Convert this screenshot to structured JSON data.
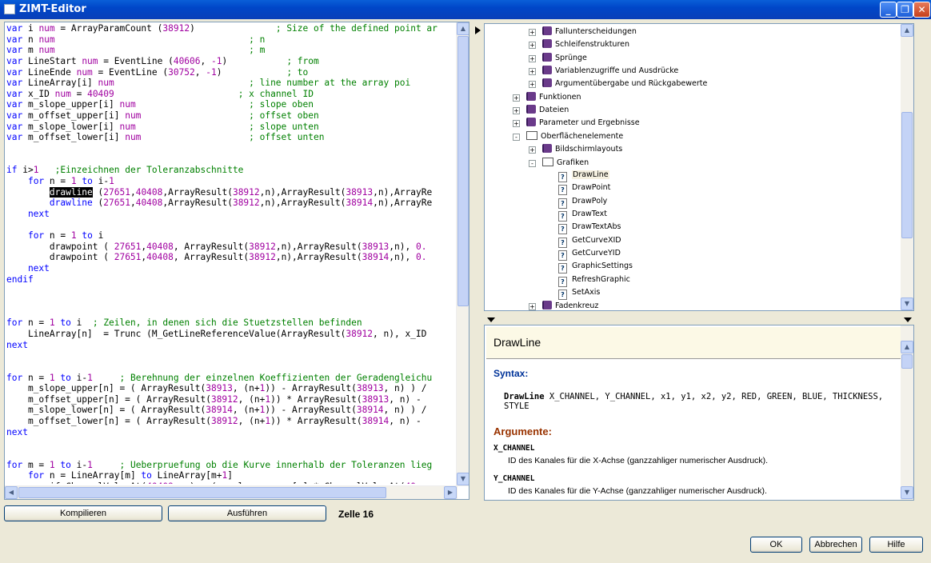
{
  "window": {
    "title": "ZIMT-Editor",
    "min_icon": "minimize-icon",
    "max_icon": "maximize-icon",
    "close_icon": "close-icon",
    "min_glyph": "_",
    "max_glyph": "❐",
    "close_glyph": "✕"
  },
  "code_lines": [
    [
      {
        "t": "var",
        "c": "kw"
      },
      {
        "t": " i "
      },
      {
        "t": "num",
        "c": "nm"
      },
      {
        "t": " = ArrayParamCount ("
      },
      {
        "t": "38912",
        "c": "nm"
      },
      {
        "t": ")               "
      },
      {
        "t": "; Size of the defined point ar",
        "c": "cm"
      }
    ],
    [
      {
        "t": "var",
        "c": "kw"
      },
      {
        "t": " n "
      },
      {
        "t": "num",
        "c": "nm"
      },
      {
        "t": "                                    "
      },
      {
        "t": "; n",
        "c": "cm"
      }
    ],
    [
      {
        "t": "var",
        "c": "kw"
      },
      {
        "t": " m "
      },
      {
        "t": "num",
        "c": "nm"
      },
      {
        "t": "                                    "
      },
      {
        "t": "; m",
        "c": "cm"
      }
    ],
    [
      {
        "t": "var",
        "c": "kw"
      },
      {
        "t": " LineStart "
      },
      {
        "t": "num",
        "c": "nm"
      },
      {
        "t": " = EventLine ("
      },
      {
        "t": "40606",
        "c": "nm"
      },
      {
        "t": ", "
      },
      {
        "t": "-1",
        "c": "nm"
      },
      {
        "t": ")           "
      },
      {
        "t": "; from",
        "c": "cm"
      }
    ],
    [
      {
        "t": "var",
        "c": "kw"
      },
      {
        "t": " LineEnde "
      },
      {
        "t": "num",
        "c": "nm"
      },
      {
        "t": " = EventLine ("
      },
      {
        "t": "30752",
        "c": "nm"
      },
      {
        "t": ", "
      },
      {
        "t": "-1",
        "c": "nm"
      },
      {
        "t": ")            "
      },
      {
        "t": "; to",
        "c": "cm"
      }
    ],
    [
      {
        "t": "var",
        "c": "kw"
      },
      {
        "t": " LineArray[i] "
      },
      {
        "t": "num",
        "c": "nm"
      },
      {
        "t": "                         "
      },
      {
        "t": "; line number at the array poi",
        "c": "cm"
      }
    ],
    [
      {
        "t": "var",
        "c": "kw"
      },
      {
        "t": " x_ID "
      },
      {
        "t": "num",
        "c": "nm"
      },
      {
        "t": " = "
      },
      {
        "t": "40409",
        "c": "nm"
      },
      {
        "t": "                       "
      },
      {
        "t": "; x channel ID",
        "c": "cm"
      }
    ],
    [
      {
        "t": "var",
        "c": "kw"
      },
      {
        "t": " m_slope_upper[i] "
      },
      {
        "t": "num",
        "c": "nm"
      },
      {
        "t": "                     "
      },
      {
        "t": "; slope oben",
        "c": "cm"
      }
    ],
    [
      {
        "t": "var",
        "c": "kw"
      },
      {
        "t": " m_offset_upper[i] "
      },
      {
        "t": "num",
        "c": "nm"
      },
      {
        "t": "                    "
      },
      {
        "t": "; offset oben",
        "c": "cm"
      }
    ],
    [
      {
        "t": "var",
        "c": "kw"
      },
      {
        "t": " m_slope_lower[i] "
      },
      {
        "t": "num",
        "c": "nm"
      },
      {
        "t": "                     "
      },
      {
        "t": "; slope unten",
        "c": "cm"
      }
    ],
    [
      {
        "t": "var",
        "c": "kw"
      },
      {
        "t": " m_offset_lower[i] "
      },
      {
        "t": "num",
        "c": "nm"
      },
      {
        "t": "                    "
      },
      {
        "t": "; offset unten",
        "c": "cm"
      }
    ],
    [],
    [],
    [
      {
        "t": "if",
        "c": "kw"
      },
      {
        "t": " i>"
      },
      {
        "t": "1",
        "c": "nm"
      },
      {
        "t": "   "
      },
      {
        "t": ";Einzeichnen der Toleranzabschnitte",
        "c": "cm"
      }
    ],
    [
      {
        "t": "    "
      },
      {
        "t": "for",
        "c": "kw"
      },
      {
        "t": " n = "
      },
      {
        "t": "1",
        "c": "nm"
      },
      {
        "t": " "
      },
      {
        "t": "to",
        "c": "kw"
      },
      {
        "t": " i-"
      },
      {
        "t": "1",
        "c": "nm"
      }
    ],
    [
      {
        "t": "        "
      },
      {
        "t": "drawline",
        "c": "sel"
      },
      {
        "t": " ("
      },
      {
        "t": "27651",
        "c": "nm"
      },
      {
        "t": ","
      },
      {
        "t": "40408",
        "c": "nm"
      },
      {
        "t": ",ArrayResult("
      },
      {
        "t": "38912",
        "c": "nm"
      },
      {
        "t": ",n),ArrayResult("
      },
      {
        "t": "38913",
        "c": "nm"
      },
      {
        "t": ",n),ArrayRe"
      }
    ],
    [
      {
        "t": "        drawline",
        "c": "kw"
      },
      {
        "t": " ("
      },
      {
        "t": "27651",
        "c": "nm"
      },
      {
        "t": ","
      },
      {
        "t": "40408",
        "c": "nm"
      },
      {
        "t": ",ArrayResult("
      },
      {
        "t": "38912",
        "c": "nm"
      },
      {
        "t": ",n),ArrayResult("
      },
      {
        "t": "38914",
        "c": "nm"
      },
      {
        "t": ",n),ArrayRe"
      }
    ],
    [
      {
        "t": "    next",
        "c": "kw"
      }
    ],
    [],
    [
      {
        "t": "    "
      },
      {
        "t": "for",
        "c": "kw"
      },
      {
        "t": " n = "
      },
      {
        "t": "1",
        "c": "nm"
      },
      {
        "t": " "
      },
      {
        "t": "to",
        "c": "kw"
      },
      {
        "t": " i"
      }
    ],
    [
      {
        "t": "        drawpoint ( "
      },
      {
        "t": "27651",
        "c": "nm"
      },
      {
        "t": ","
      },
      {
        "t": "40408",
        "c": "nm"
      },
      {
        "t": ", ArrayResult("
      },
      {
        "t": "38912",
        "c": "nm"
      },
      {
        "t": ",n),ArrayResult("
      },
      {
        "t": "38913",
        "c": "nm"
      },
      {
        "t": ",n), "
      },
      {
        "t": "0.",
        "c": "nm"
      }
    ],
    [
      {
        "t": "        drawpoint ( "
      },
      {
        "t": "27651",
        "c": "nm"
      },
      {
        "t": ","
      },
      {
        "t": "40408",
        "c": "nm"
      },
      {
        "t": ", ArrayResult("
      },
      {
        "t": "38912",
        "c": "nm"
      },
      {
        "t": ",n),ArrayResult("
      },
      {
        "t": "38914",
        "c": "nm"
      },
      {
        "t": ",n), "
      },
      {
        "t": "0.",
        "c": "nm"
      }
    ],
    [
      {
        "t": "    next",
        "c": "kw"
      }
    ],
    [
      {
        "t": "endif",
        "c": "kw"
      }
    ],
    [],
    [],
    [],
    [
      {
        "t": "for",
        "c": "kw"
      },
      {
        "t": " n = "
      },
      {
        "t": "1",
        "c": "nm"
      },
      {
        "t": " "
      },
      {
        "t": "to",
        "c": "kw"
      },
      {
        "t": " i  "
      },
      {
        "t": "; Zeilen, in denen sich die Stuetzstellen befinden",
        "c": "cm"
      }
    ],
    [
      {
        "t": "    LineArray[n]  = Trunc (M_GetLineReferenceValue(ArrayResult("
      },
      {
        "t": "38912",
        "c": "nm"
      },
      {
        "t": ", n), x_ID"
      }
    ],
    [
      {
        "t": "next",
        "c": "kw"
      }
    ],
    [],
    [],
    [
      {
        "t": "for",
        "c": "kw"
      },
      {
        "t": " n = "
      },
      {
        "t": "1",
        "c": "nm"
      },
      {
        "t": " "
      },
      {
        "t": "to",
        "c": "kw"
      },
      {
        "t": " i-"
      },
      {
        "t": "1",
        "c": "nm"
      },
      {
        "t": "     "
      },
      {
        "t": "; Berehnung der einzelnen Koeffizienten der Geradengleichu",
        "c": "cm"
      }
    ],
    [
      {
        "t": "    m_slope_upper[n] = ( ArrayResult("
      },
      {
        "t": "38913",
        "c": "nm"
      },
      {
        "t": ", (n+"
      },
      {
        "t": "1",
        "c": "nm"
      },
      {
        "t": ")) - ArrayResult("
      },
      {
        "t": "38913",
        "c": "nm"
      },
      {
        "t": ", n) ) /"
      }
    ],
    [
      {
        "t": "    m_offset_upper[n] = ( ArrayResult("
      },
      {
        "t": "38912",
        "c": "nm"
      },
      {
        "t": ", (n+"
      },
      {
        "t": "1",
        "c": "nm"
      },
      {
        "t": ")) * ArrayResult("
      },
      {
        "t": "38913",
        "c": "nm"
      },
      {
        "t": ", n) -"
      }
    ],
    [
      {
        "t": "    m_slope_lower[n] = ( ArrayResult("
      },
      {
        "t": "38914",
        "c": "nm"
      },
      {
        "t": ", (n+"
      },
      {
        "t": "1",
        "c": "nm"
      },
      {
        "t": ")) - ArrayResult("
      },
      {
        "t": "38914",
        "c": "nm"
      },
      {
        "t": ", n) ) /"
      }
    ],
    [
      {
        "t": "    m_offset_lower[n] = ( ArrayResult("
      },
      {
        "t": "38912",
        "c": "nm"
      },
      {
        "t": ", (n+"
      },
      {
        "t": "1",
        "c": "nm"
      },
      {
        "t": ")) * ArrayResult("
      },
      {
        "t": "38914",
        "c": "nm"
      },
      {
        "t": ", n) -"
      }
    ],
    [
      {
        "t": "next",
        "c": "kw"
      }
    ],
    [],
    [],
    [
      {
        "t": "for",
        "c": "kw"
      },
      {
        "t": " m = "
      },
      {
        "t": "1",
        "c": "nm"
      },
      {
        "t": " "
      },
      {
        "t": "to",
        "c": "kw"
      },
      {
        "t": " i-"
      },
      {
        "t": "1",
        "c": "nm"
      },
      {
        "t": "     "
      },
      {
        "t": "; Ueberpruefung ob die Kurve innerhalb der Toleranzen lieg",
        "c": "cm"
      }
    ],
    [
      {
        "t": "    "
      },
      {
        "t": "for",
        "c": "kw"
      },
      {
        "t": " n = LineArray[m] "
      },
      {
        "t": "to",
        "c": "kw"
      },
      {
        "t": " LineArray[m+"
      },
      {
        "t": "1",
        "c": "nm"
      },
      {
        "t": "]"
      }
    ],
    [
      {
        "t": "        if ChannelValueAt("
      },
      {
        "t": "40409",
        "c": "nm"
      },
      {
        "t": ", n) > ( m_slope_upper[m] * ChannelValueAt("
      },
      {
        "t": "40",
        "c": "nm"
      }
    ]
  ],
  "tree": [
    {
      "label": "Fallunterscheidungen",
      "level": 3,
      "icon": "book",
      "exp": "+"
    },
    {
      "label": "Schleifenstrukturen",
      "level": 3,
      "icon": "book",
      "exp": "+"
    },
    {
      "label": "Sprünge",
      "level": 3,
      "icon": "book",
      "exp": "+"
    },
    {
      "label": "Variablenzugriffe und Ausdrücke",
      "level": 3,
      "icon": "book",
      "exp": "+"
    },
    {
      "label": "Argumentübergabe und Rückgabewerte",
      "level": 3,
      "icon": "book",
      "exp": "+"
    },
    {
      "label": "Funktionen",
      "level": 2,
      "icon": "book",
      "exp": "+"
    },
    {
      "label": "Dateien",
      "level": 2,
      "icon": "book",
      "exp": "+"
    },
    {
      "label": "Parameter und Ergebnisse",
      "level": 2,
      "icon": "book",
      "exp": "+"
    },
    {
      "label": "Oberflächenelemente",
      "level": 2,
      "icon": "bookopen",
      "exp": "-"
    },
    {
      "label": "Bildschirmlayouts",
      "level": 3,
      "icon": "book",
      "exp": "+"
    },
    {
      "label": "Grafiken",
      "level": 3,
      "icon": "bookopen",
      "exp": "-"
    },
    {
      "label": "DrawLine",
      "level": 4,
      "icon": "page",
      "selected": true
    },
    {
      "label": "DrawPoint",
      "level": 4,
      "icon": "page"
    },
    {
      "label": "DrawPoly",
      "level": 4,
      "icon": "page"
    },
    {
      "label": "DrawText",
      "level": 4,
      "icon": "page"
    },
    {
      "label": "DrawTextAbs",
      "level": 4,
      "icon": "page"
    },
    {
      "label": "GetCurveXID",
      "level": 4,
      "icon": "page"
    },
    {
      "label": "GetCurveYID",
      "level": 4,
      "icon": "page"
    },
    {
      "label": "GraphicSettings",
      "level": 4,
      "icon": "page"
    },
    {
      "label": "RefreshGraphic",
      "level": 4,
      "icon": "page"
    },
    {
      "label": "SetAxis",
      "level": 4,
      "icon": "page"
    },
    {
      "label": "Fadenkreuz",
      "level": 3,
      "icon": "book",
      "exp": "+"
    }
  ],
  "help": {
    "title": "DrawLine",
    "syntax_label": "Syntax:",
    "syntax_cmd": "DrawLine",
    "syntax_args": " X_CHANNEL, Y_CHANNEL, x1, y1, x2, y2, RED, GREEN, BLUE, THICKNESS, STYLE",
    "args_label": "Argumente:",
    "arg1_name": "X_CHANNEL",
    "arg1_desc": "ID des Kanales für die X-Achse (ganzzahliger numerischer Ausdruck).",
    "arg2_name": "Y_CHANNEL",
    "arg2_desc": "ID des Kanales für die Y-Achse (ganzzahliger numerischer Ausdruck)."
  },
  "buttons": {
    "compile": "Kompilieren",
    "run": "Ausführen",
    "ok": "OK",
    "cancel": "Abbrechen",
    "help": "Hilfe"
  },
  "status": {
    "line": "Zelle 16"
  },
  "colors": {
    "keyword": "#0000ff",
    "number": "#a000a0",
    "comment": "#008000",
    "title_bar": "#0046c8"
  }
}
